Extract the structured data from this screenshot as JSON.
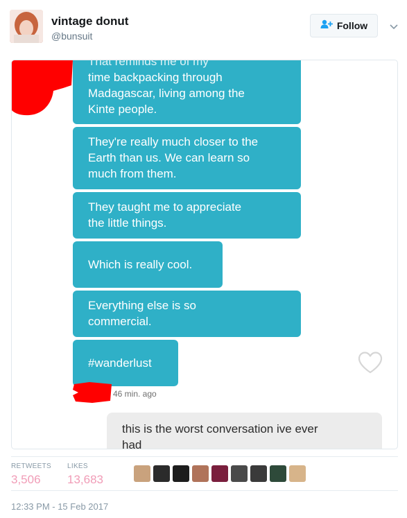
{
  "author": {
    "name": "vintage donut",
    "handle": "@bunsuit"
  },
  "follow_button": {
    "label": "Follow",
    "icon": "add-user-icon"
  },
  "conversation": {
    "partial_top_text": "That reminds me of my",
    "messages": [
      {
        "lines": [
          "time backpacking through",
          "Madagascar, living among the",
          "Kinte people."
        ]
      },
      {
        "lines": [
          "They're really much closer to the",
          "Earth than us. We can learn so",
          "much from them."
        ]
      },
      {
        "lines": [
          "They taught me to appreciate",
          "the little things."
        ]
      },
      {
        "lines": [
          "Which is really cool."
        ]
      },
      {
        "lines": [
          "Everything else is so",
          "commercial."
        ]
      },
      {
        "lines": [
          "#wanderlust"
        ]
      }
    ],
    "time_ago": "46 min. ago",
    "reply": {
      "lines": [
        "this is the worst conversation ive ever",
        "had"
      ]
    },
    "bubble_color": "#2fb0c7",
    "redaction_color": "#ff0000"
  },
  "stats": {
    "retweets_label": "RETWEETS",
    "retweets_value": "3,506",
    "likes_label": "LIKES",
    "likes_value": "13,683"
  },
  "liker_avatars": [
    "#c9a27d",
    "#2b2b2b",
    "#1d1d1d",
    "#b0735a",
    "#7a1f3d",
    "#4a4a4a",
    "#3a3a3a",
    "#2e4a3a",
    "#d7b48a"
  ],
  "timestamp": "12:33 PM - 15 Feb 2017"
}
